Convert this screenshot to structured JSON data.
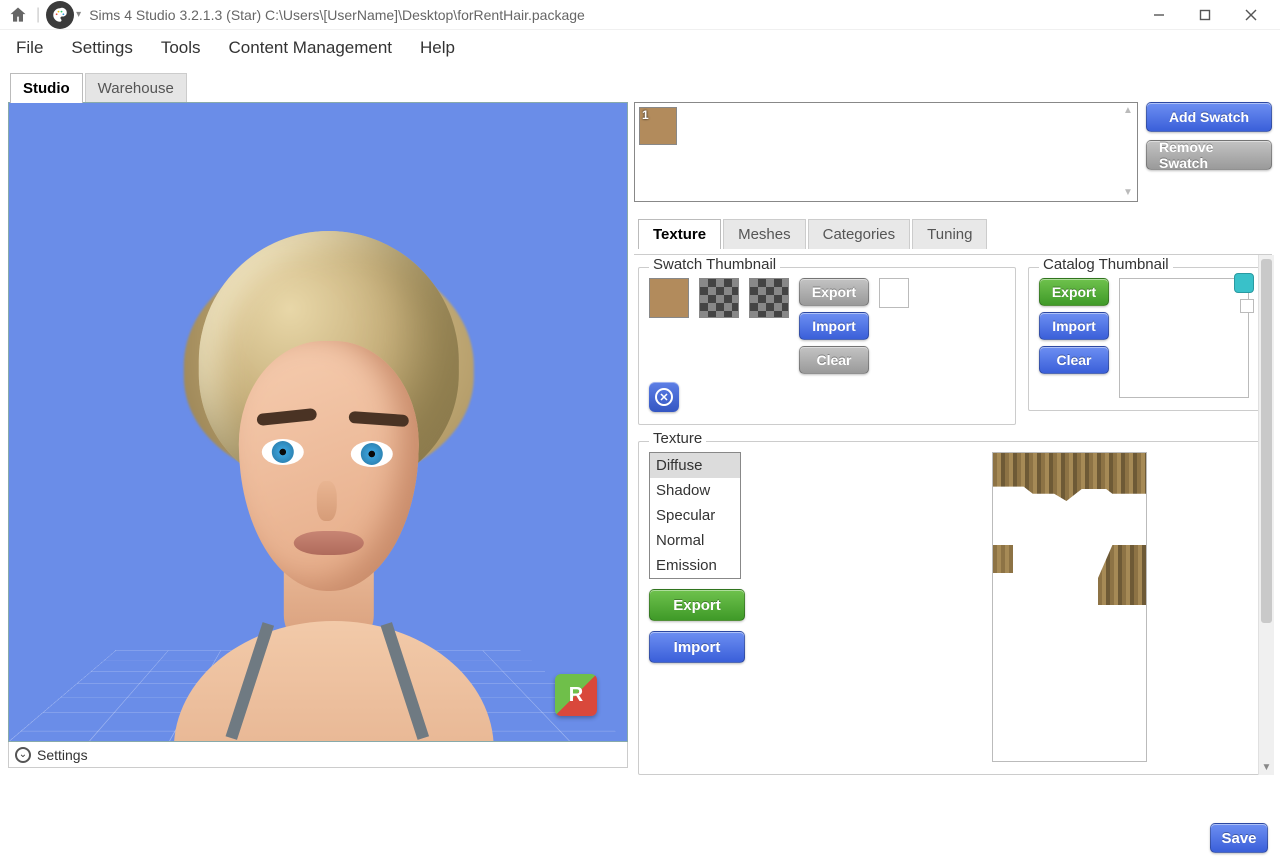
{
  "title": "Sims 4 Studio 3.2.1.3 (Star)  C:\\Users\\[UserName]\\Desktop\\forRentHair.package",
  "menu": {
    "file": "File",
    "settings": "Settings",
    "tools": "Tools",
    "content": "Content Management",
    "help": "Help"
  },
  "tabs": {
    "studio": "Studio",
    "warehouse": "Warehouse"
  },
  "preview": {
    "settings_label": "Settings",
    "cube_letter": "R"
  },
  "swatch": {
    "items": [
      {
        "num": "1",
        "color": "#b28b5c"
      }
    ],
    "add": "Add Swatch",
    "remove": "Remove Swatch"
  },
  "subtabs": {
    "texture": "Texture",
    "meshes": "Meshes",
    "categories": "Categories",
    "tuning": "Tuning"
  },
  "swatch_thumb": {
    "legend": "Swatch Thumbnail",
    "export": "Export",
    "import": "Import",
    "clear": "Clear"
  },
  "catalog_thumb": {
    "legend": "Catalog Thumbnail",
    "export": "Export",
    "import": "Import",
    "clear": "Clear"
  },
  "texture": {
    "legend": "Texture",
    "list": [
      "Diffuse",
      "Shadow",
      "Specular",
      "Normal",
      "Emission"
    ],
    "selected": "Diffuse",
    "export": "Export",
    "import": "Import"
  },
  "save": "Save"
}
